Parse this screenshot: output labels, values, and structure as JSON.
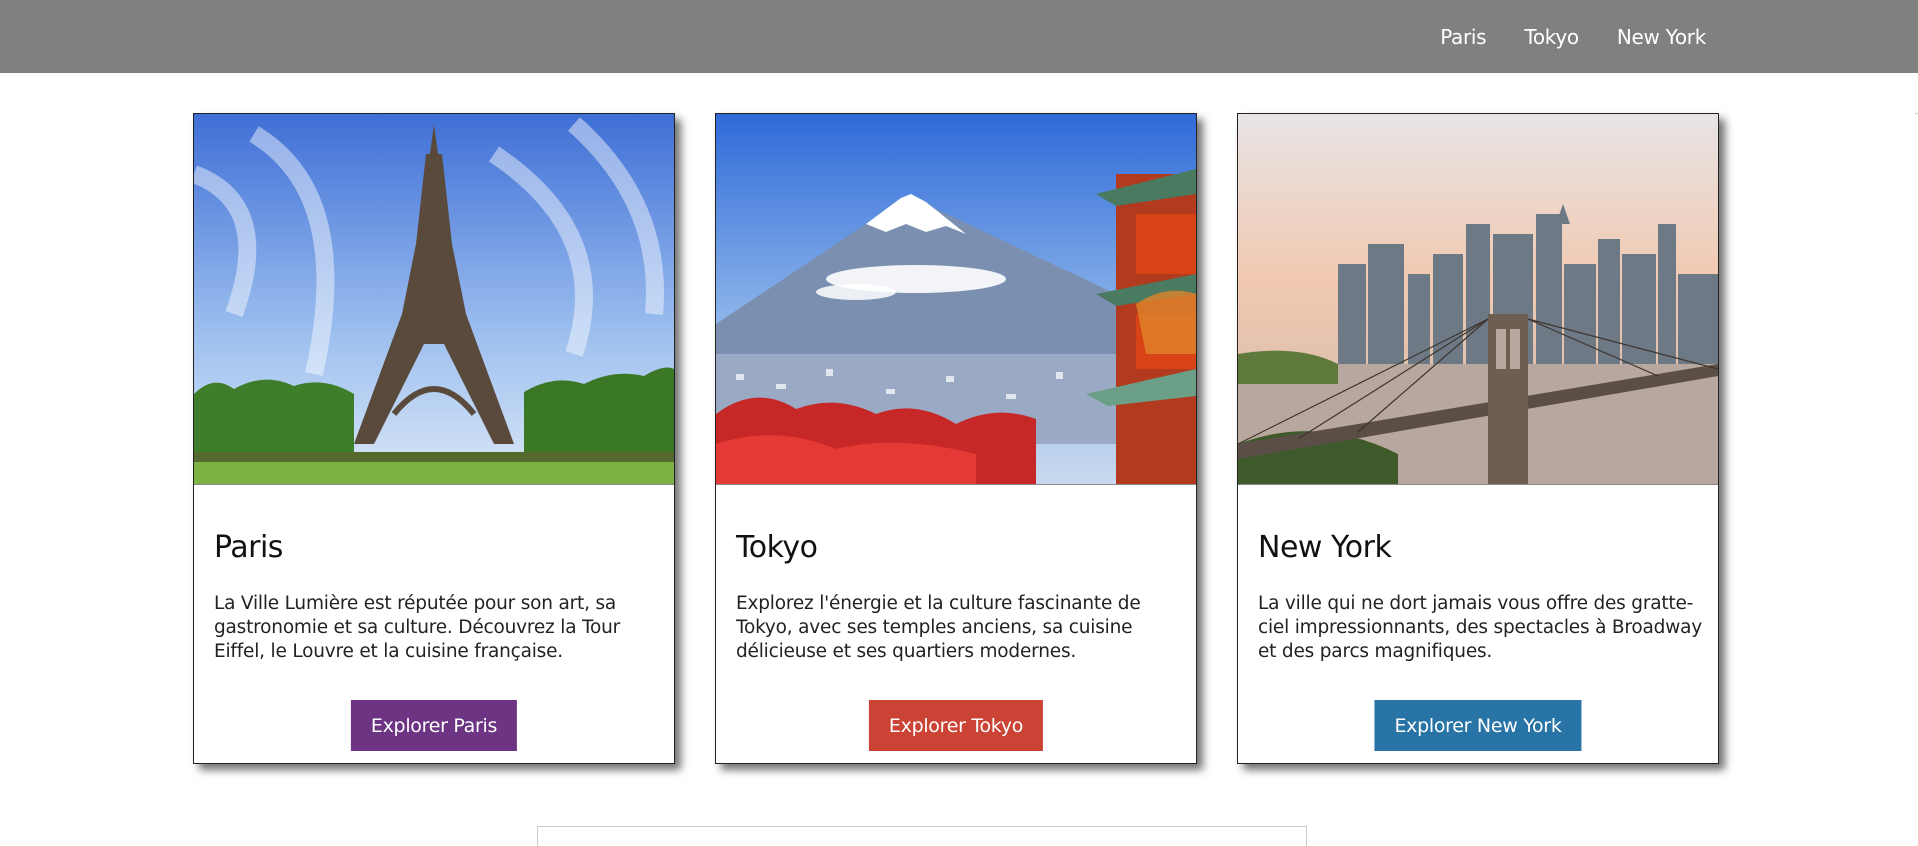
{
  "nav": {
    "items": [
      {
        "label": "Paris"
      },
      {
        "label": "Tokyo"
      },
      {
        "label": "New York"
      }
    ]
  },
  "cards": [
    {
      "title": "Paris",
      "text": "La Ville Lumière est réputée pour son art, sa gastronomie et sa culture. Découvrez la Tour Eiffel, le Louvre et la cuisine française.",
      "button": "Explorer Paris",
      "button_color": "#6c3483",
      "image": "eiffel-tower-photo"
    },
    {
      "title": "Tokyo",
      "text": "Explorez l'énergie et la culture fascinante de Tokyo, avec ses temples anciens, sa cuisine délicieuse et ses quartiers modernes.",
      "button": "Explorer Tokyo",
      "button_color": "#cb4335",
      "image": "mount-fuji-pagoda-photo"
    },
    {
      "title": "New York",
      "text": "La ville qui ne dort jamais vous offre des gratte-ciel impressionnants, des spectacles à Broadway et des parcs magnifiques.",
      "button": "Explorer New York",
      "button_color": "#2874a6",
      "image": "brooklyn-bridge-skyline-photo"
    }
  ]
}
